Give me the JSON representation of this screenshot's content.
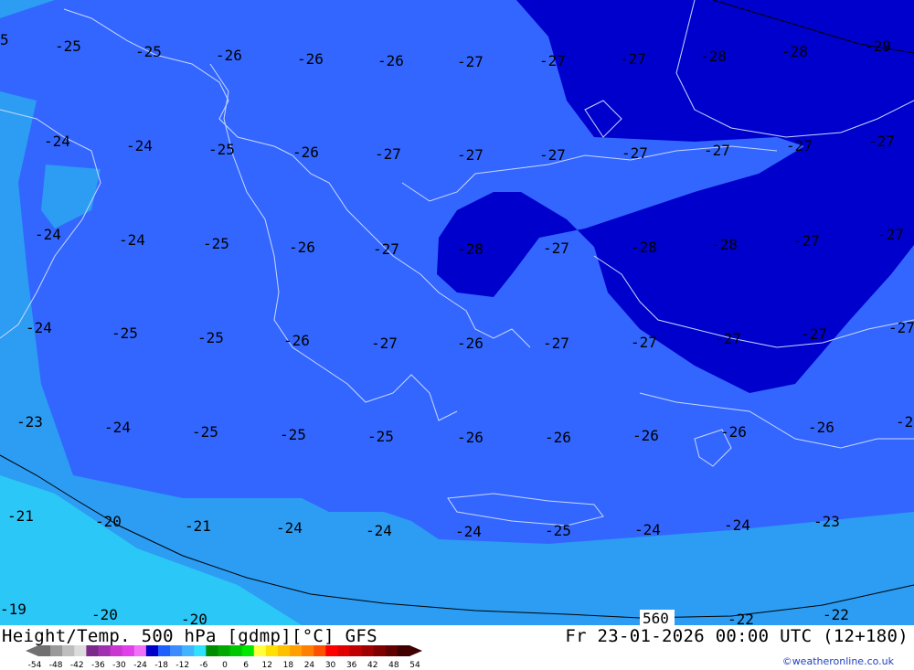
{
  "map": {
    "contour_label": "560",
    "temperature_labels": [
      {
        "t": "5"
      },
      {
        "t": "-25"
      },
      {
        "t": "-25"
      },
      {
        "t": "-26"
      },
      {
        "t": "-26"
      },
      {
        "t": "-26"
      },
      {
        "t": "-27"
      },
      {
        "t": "-27"
      },
      {
        "t": "-27"
      },
      {
        "t": "-28"
      },
      {
        "t": "-28"
      },
      {
        "t": "-29"
      },
      {
        "t": "-24"
      },
      {
        "t": "-24"
      },
      {
        "t": "-25"
      },
      {
        "t": "-26"
      },
      {
        "t": "-27"
      },
      {
        "t": "-27"
      },
      {
        "t": "-27"
      },
      {
        "t": "-27"
      },
      {
        "t": "-27"
      },
      {
        "t": "-27"
      },
      {
        "t": "-27"
      },
      {
        "t": "-24"
      },
      {
        "t": "-24"
      },
      {
        "t": "-25"
      },
      {
        "t": "-26"
      },
      {
        "t": "-27"
      },
      {
        "t": "-28"
      },
      {
        "t": "-27"
      },
      {
        "t": "-28"
      },
      {
        "t": "-28"
      },
      {
        "t": "-27"
      },
      {
        "t": "-27"
      },
      {
        "t": "-24"
      },
      {
        "t": "-25"
      },
      {
        "t": "-25"
      },
      {
        "t": "-26"
      },
      {
        "t": "-27"
      },
      {
        "t": "-26"
      },
      {
        "t": "-27"
      },
      {
        "t": "-27"
      },
      {
        "t": "-27"
      },
      {
        "t": "-27"
      },
      {
        "t": "-27"
      },
      {
        "t": "-23"
      },
      {
        "t": "-24"
      },
      {
        "t": "-25"
      },
      {
        "t": "-25"
      },
      {
        "t": "-25"
      },
      {
        "t": "-26"
      },
      {
        "t": "-26"
      },
      {
        "t": "-26"
      },
      {
        "t": "-26"
      },
      {
        "t": "-26"
      },
      {
        "t": "-2"
      },
      {
        "t": "-21"
      },
      {
        "t": "-20"
      },
      {
        "t": "-21"
      },
      {
        "t": "-24"
      },
      {
        "t": "-24"
      },
      {
        "t": "-24"
      },
      {
        "t": "-25"
      },
      {
        "t": "-24"
      },
      {
        "t": "-24"
      },
      {
        "t": "-23"
      },
      {
        "t": "-19"
      },
      {
        "t": "-20"
      },
      {
        "t": "-20"
      },
      {
        "t": "-22"
      },
      {
        "t": "-22"
      }
    ],
    "colors": {
      "band_19_22": "#2bc7f7",
      "band_22_24": "#2c9df3",
      "band_24_27": "#3366ff",
      "band_27_30": "#0000cc",
      "coast": "#c8d8ff"
    }
  },
  "footer": {
    "title": "Height/Temp. 500 hPa [gdmp][°C] GFS",
    "time": "Fr 23-01-2026 00:00 UTC (12+180)",
    "credit": "©weatheronline.co.uk",
    "scale_labels": [
      "-54",
      "-48",
      "-42",
      "-36",
      "-30",
      "-24",
      "-18",
      "-12",
      "-6",
      "0",
      "6",
      "12",
      "18",
      "24",
      "30",
      "36",
      "42",
      "48",
      "54"
    ],
    "scale_colors": [
      "#707070",
      "#9a9a9a",
      "#bebebe",
      "#dcdcdc",
      "#7a2a8a",
      "#a030b0",
      "#c838d0",
      "#e040e8",
      "#f070f8",
      "#0000c8",
      "#2060ff",
      "#3c8cff",
      "#40b4ff",
      "#30e0ff",
      "#008c00",
      "#00a800",
      "#00c800",
      "#00e800",
      "#ffff40",
      "#ffe000",
      "#ffc000",
      "#ffa000",
      "#ff8000",
      "#ff5000",
      "#ff0000",
      "#e00000",
      "#c00000",
      "#a00000",
      "#800000",
      "#600000",
      "#400000"
    ]
  }
}
